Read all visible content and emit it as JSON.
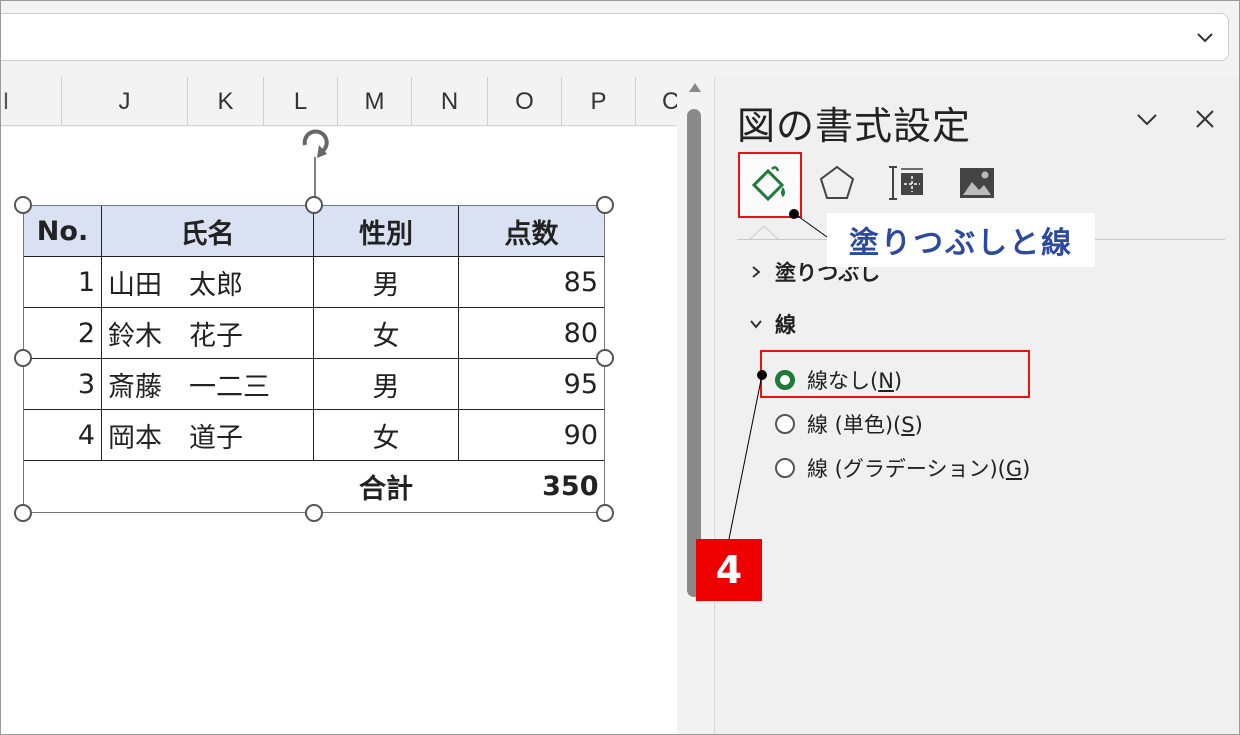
{
  "formula_bar": {
    "expand_icon": "chevron-down-icon"
  },
  "columns": [
    "J",
    "K",
    "L",
    "M",
    "N",
    "O",
    "P",
    "C"
  ],
  "table": {
    "headers": [
      "No.",
      "氏名",
      "性別",
      "点数"
    ],
    "rows": [
      {
        "no": "1",
        "name": "山田　太郎",
        "gender": "男",
        "score": "85"
      },
      {
        "no": "2",
        "name": "鈴木　花子",
        "gender": "女",
        "score": "80"
      },
      {
        "no": "3",
        "name": "斎藤　一二三",
        "gender": "男",
        "score": "95"
      },
      {
        "no": "4",
        "name": "岡本　道子",
        "gender": "女",
        "score": "90"
      }
    ],
    "total_label": "合計",
    "total_value": "350"
  },
  "pane": {
    "title": "図の書式設定",
    "collapse_icon": "chevron-down-icon",
    "close_icon": "close-icon",
    "tabs": [
      "fill-line-icon",
      "effects-pentagon-icon",
      "size-layout-icon",
      "picture-icon"
    ],
    "callout": "塗りつぶしと線",
    "section_fill": "塗りつぶし",
    "section_line": "線",
    "line_options": [
      {
        "label_prefix": "線なし(",
        "key": "N",
        "label_suffix": ")",
        "selected": true
      },
      {
        "label_prefix": "線 (単色)(",
        "key": "S",
        "label_suffix": ")",
        "selected": false
      },
      {
        "label_prefix": "線 (グラデーション)(",
        "key": "G",
        "label_suffix": ")",
        "selected": false
      }
    ],
    "step_number": "4"
  },
  "colors": {
    "accent_green": "#1e7a3a",
    "highlight_red": "#e11111",
    "callout_blue": "#2b4aa0",
    "header_fill": "#d9e1f2"
  }
}
